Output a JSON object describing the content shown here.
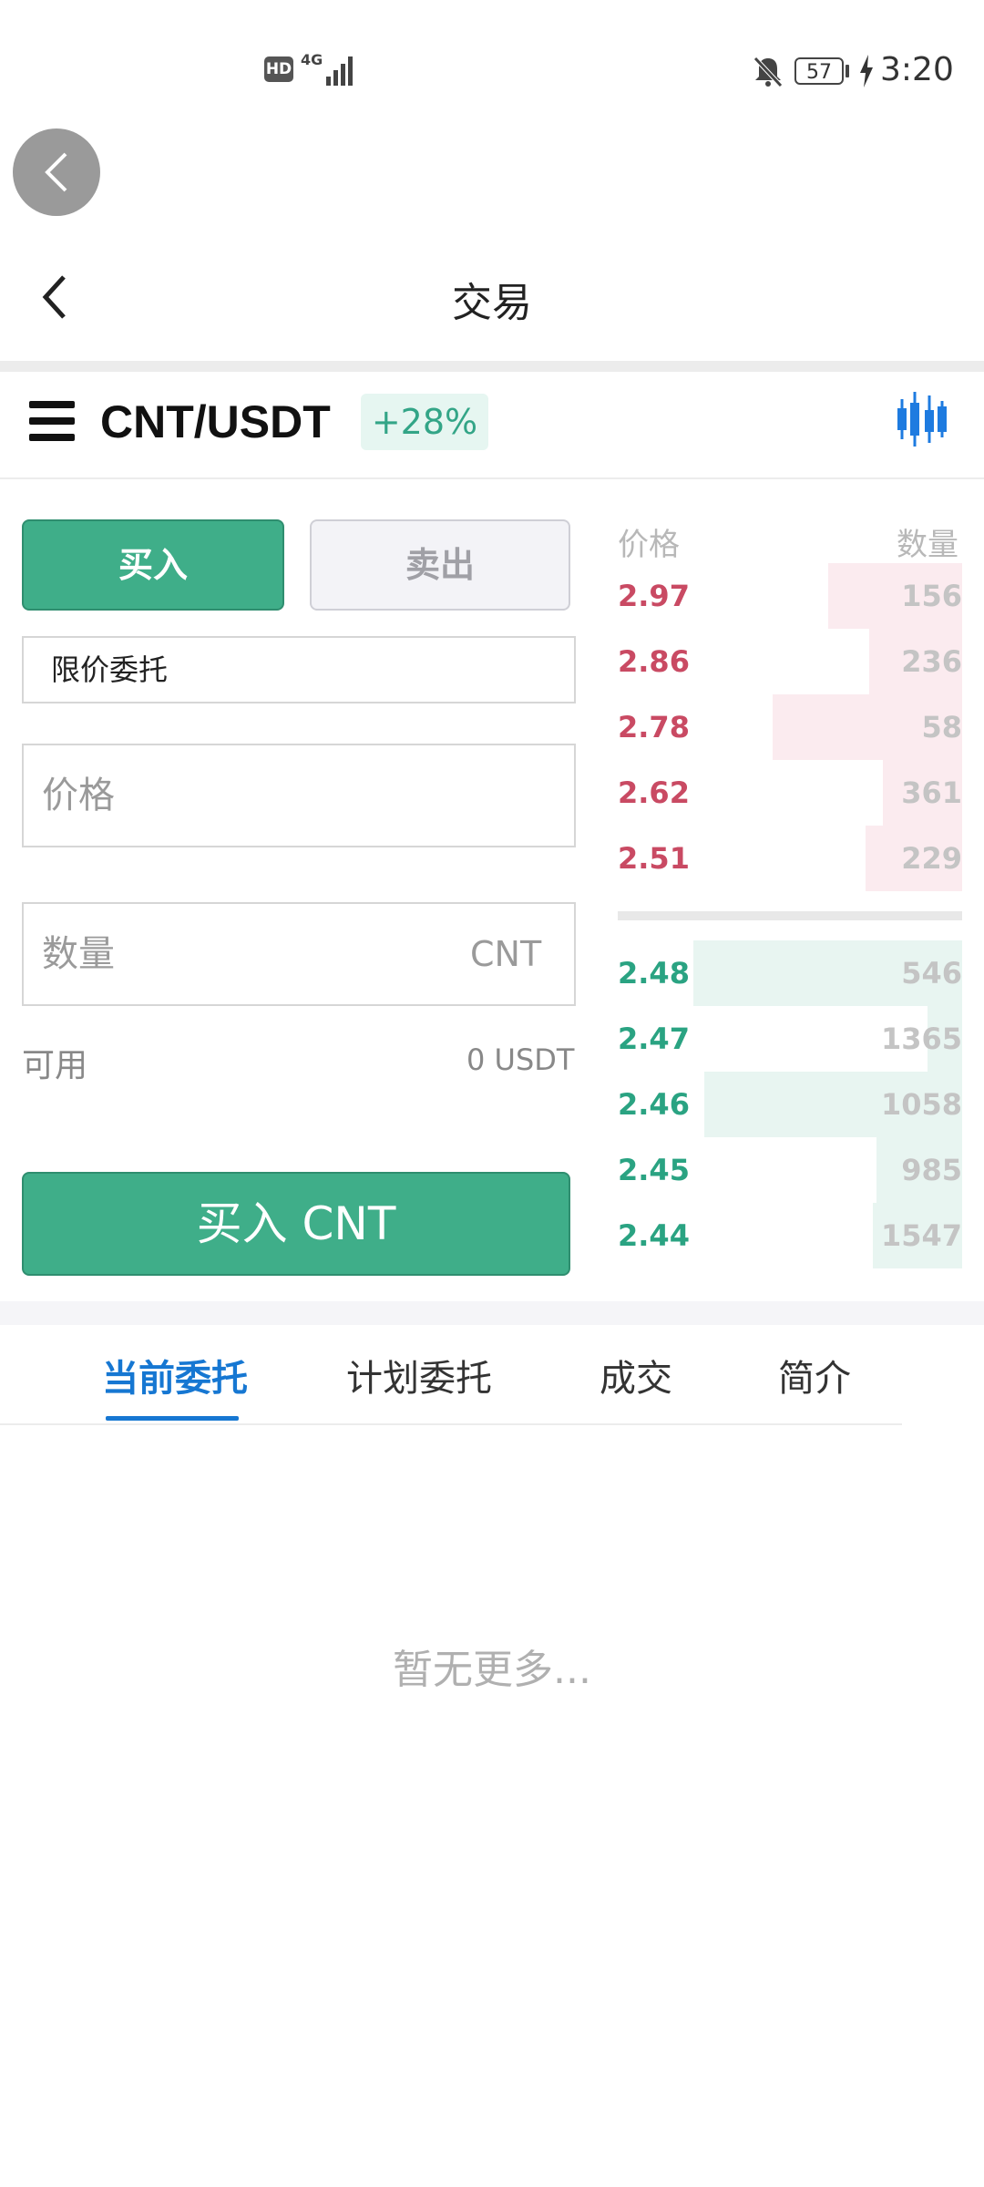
{
  "status_bar": {
    "hd": "HD",
    "network": "4G",
    "battery": "57",
    "time": "3:20"
  },
  "header": {
    "title": "交易"
  },
  "pair_bar": {
    "pair": "CNT/USDT",
    "change": "+28%"
  },
  "trade_form": {
    "buy_tab": "买入",
    "sell_tab": "卖出",
    "order_type": "限价委托",
    "price_placeholder": "价格",
    "qty_placeholder": "数量",
    "qty_unit": "CNT",
    "available_label": "可用",
    "available_value": "0 USDT",
    "submit_label": "买入 CNT"
  },
  "order_book": {
    "price_header": "价格",
    "qty_header": "数量",
    "asks": [
      {
        "price": "2.97",
        "qty": "156",
        "depth": 0.39
      },
      {
        "price": "2.86",
        "qty": "236",
        "depth": 0.27
      },
      {
        "price": "2.78",
        "qty": "58",
        "depth": 0.55
      },
      {
        "price": "2.62",
        "qty": "361",
        "depth": 0.23
      },
      {
        "price": "2.51",
        "qty": "229",
        "depth": 0.28
      }
    ],
    "bids": [
      {
        "price": "2.48",
        "qty": "546",
        "depth": 0.78
      },
      {
        "price": "2.47",
        "qty": "1365",
        "depth": 0.1
      },
      {
        "price": "2.46",
        "qty": "1058",
        "depth": 0.75
      },
      {
        "price": "2.45",
        "qty": "985",
        "depth": 0.25
      },
      {
        "price": "2.44",
        "qty": "1547",
        "depth": 0.26
      }
    ]
  },
  "tabs": [
    {
      "label": "当前委托",
      "active": true
    },
    {
      "label": "计划委托",
      "active": false
    },
    {
      "label": "成交",
      "active": false
    },
    {
      "label": "简介",
      "active": false
    }
  ],
  "empty_text": "暂无更多...",
  "colors": {
    "buy_green": "#3fae89",
    "ask_red": "#c94a63",
    "bid_green": "#2aa382",
    "active_tab_blue": "#1677d2",
    "chart_icon_blue": "#1e7be0"
  },
  "icons": {
    "float_back": "chevron-left-icon",
    "header_back": "chevron-left-icon",
    "menu": "hamburger-menu-icon",
    "chart": "candlestick-chart-icon",
    "bell": "bell-muted-icon",
    "charging": "charging-bolt-icon"
  }
}
